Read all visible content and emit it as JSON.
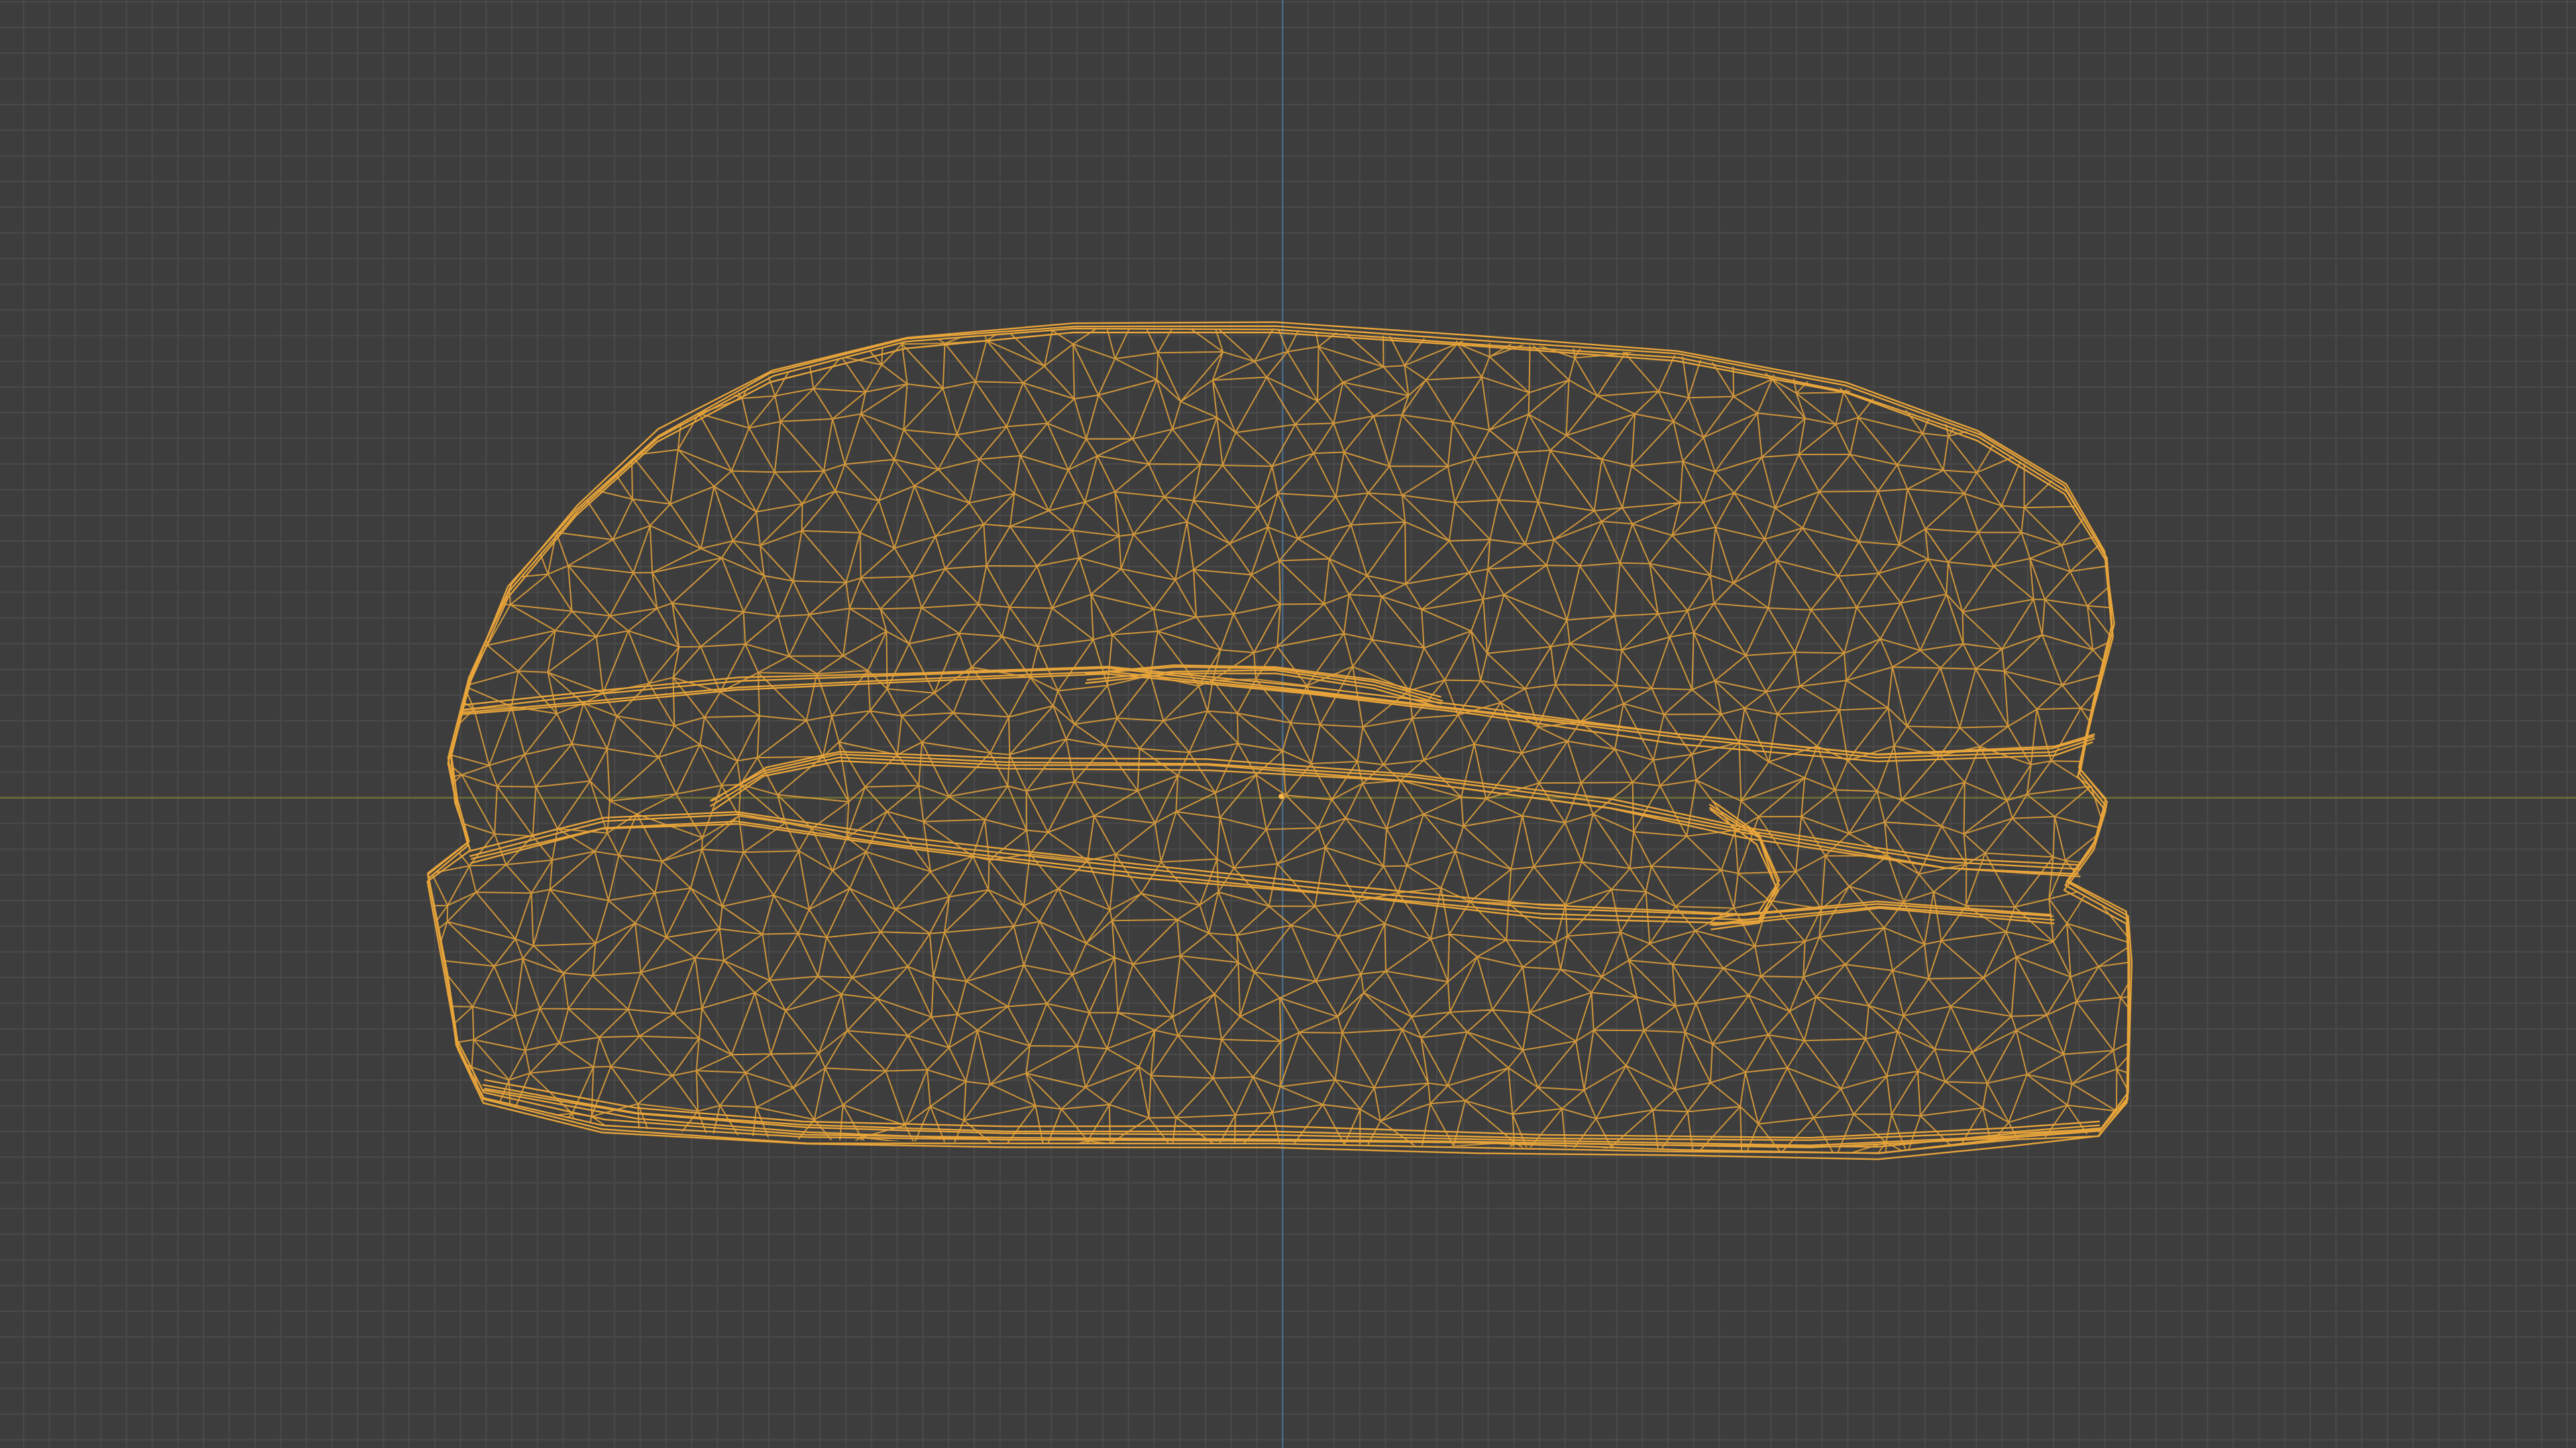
{
  "viewport": {
    "name": "3D viewport",
    "background_color": "#3d3d3d",
    "grid_color": "#4a4a4a",
    "x_axis_color": "#6f7036",
    "y_axis_color": "#4a6a86"
  },
  "object": {
    "name": "burger-wireframe-mesh",
    "display_mode": "wireframe",
    "wire_color": "#e7a43a",
    "selected": true
  }
}
